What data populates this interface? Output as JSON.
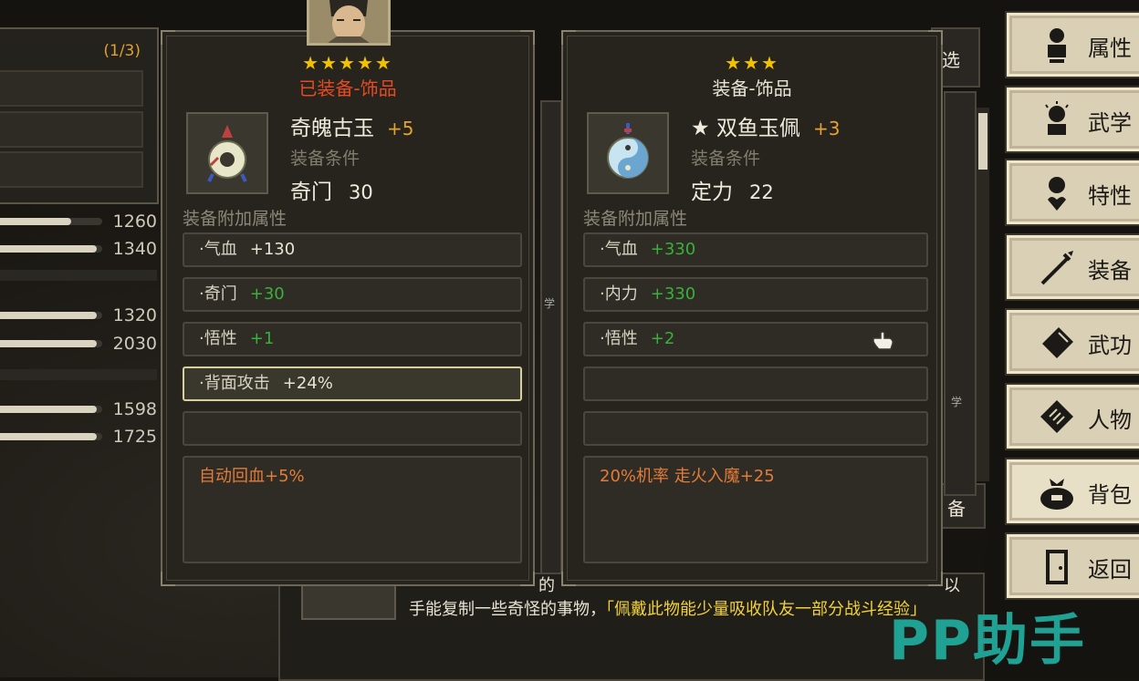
{
  "left_panel": {
    "count": "(1/3)",
    "stats": [
      "1260",
      "1340",
      "1320",
      "2030",
      "1598",
      "1725"
    ],
    "stat_fill": [
      0.7,
      0.95,
      0.95,
      0.95,
      0.95,
      0.95
    ]
  },
  "current_item": {
    "stars": "★★★★★",
    "tag": "已装备-饰品",
    "name": "奇魄古玉",
    "plus": "+5",
    "req_label": "装备条件",
    "req_attr": "奇门",
    "req_value": "30",
    "attr_label": "装备附加属性",
    "attrs": [
      {
        "name": "·气血",
        "value": "+130"
      },
      {
        "name": "·奇门",
        "value": "+30"
      },
      {
        "name": "·悟性",
        "value": "+1"
      },
      {
        "name": "·背面攻击",
        "value": "+24%"
      }
    ],
    "effect": "自动回血+5%"
  },
  "compare_item": {
    "stars": "★★★",
    "tag": "装备-饰品",
    "name": "★ 双鱼玉佩",
    "plus": "+3",
    "req_label": "装备条件",
    "req_attr": "定力",
    "req_value": "22",
    "attr_label": "装备附加属性",
    "attrs": [
      {
        "name": "·气血",
        "value": "+330"
      },
      {
        "name": "·内力",
        "value": "+330"
      },
      {
        "name": "·悟性",
        "value": "+2"
      }
    ],
    "effect": "20%机率 走火入魔+25"
  },
  "menu": [
    "属性",
    "武学",
    "特性",
    "装备",
    "武功",
    "人物",
    "背包",
    "返回"
  ],
  "fragments": {
    "top_right": "选",
    "mid_right": "备",
    "side1": "学",
    "side2": "学",
    "bottom_left": "的",
    "bottom_right": "以"
  },
  "description": {
    "plain": "手能复制一些奇怪的事物，",
    "highlight": "「佩戴此物能少量吸收队友一部分战斗经验」"
  },
  "watermark": "PP助手"
}
